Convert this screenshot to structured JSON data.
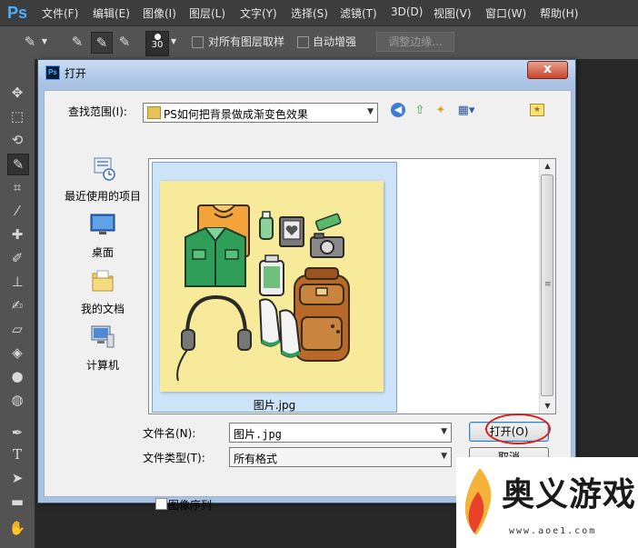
{
  "app": {
    "logo_text": "Ps",
    "menu": [
      "文件(F)",
      "编辑(E)",
      "图像(I)",
      "图层(L)",
      "文字(Y)",
      "选择(S)",
      "滤镜(T)",
      "3D(D)",
      "视图(V)",
      "窗口(W)",
      "帮助(H)"
    ]
  },
  "options_bar": {
    "brush_size": "30",
    "sample_all_layers_label": "对所有图层取样",
    "auto_enhance_label": "自动增强",
    "refine_edge_label": "调整边缘..."
  },
  "dialog": {
    "title": "打开",
    "close_label": "x",
    "look_in_label": "查找范围(I):",
    "look_in_value": "PS如何把背景做成渐变色效果",
    "places": [
      {
        "label": "最近使用的项目",
        "icon": "recent-items-icon"
      },
      {
        "label": "桌面",
        "icon": "desktop-icon"
      },
      {
        "label": "我的文档",
        "icon": "documents-folder-icon"
      },
      {
        "label": "计算机",
        "icon": "computer-icon"
      }
    ],
    "files": [
      {
        "name": "图片.jpg",
        "selected": true
      }
    ],
    "file_name_label": "文件名(N):",
    "file_name_value": "图片.jpg",
    "file_type_label": "文件类型(T):",
    "file_type_value": "所有格式",
    "open_button": "打开(O)",
    "cancel_button": "取消",
    "image_sequence_label": "图像序列",
    "image_sequence_checked": false
  },
  "watermark": {
    "text": "奥义游戏网",
    "url": "www.aoe1.com"
  },
  "colors": {
    "dialog_frame": "#aac2e2",
    "selection": "#cde3f9",
    "highlight_circle": "#d91c1c"
  }
}
